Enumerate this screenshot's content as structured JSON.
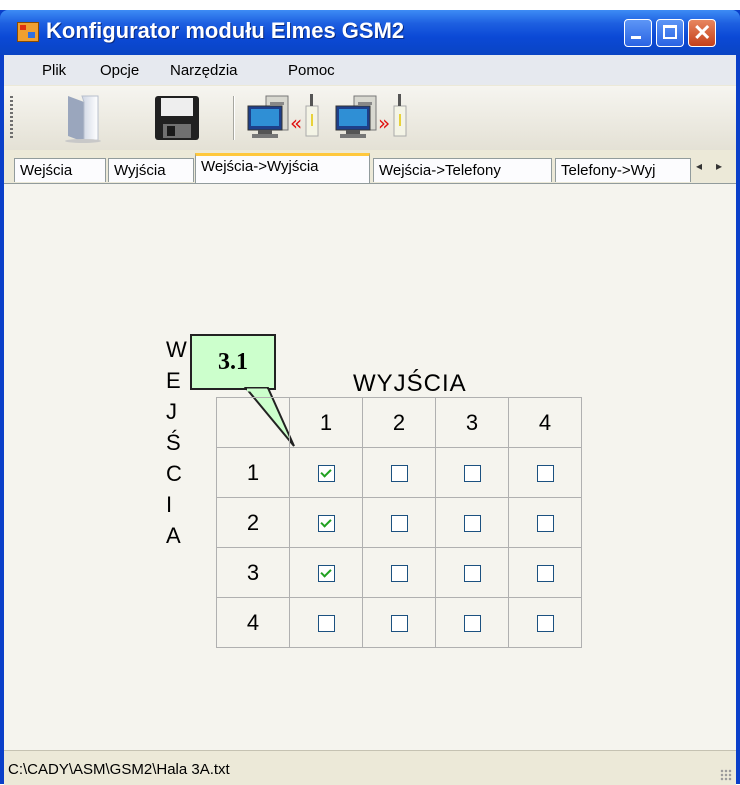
{
  "window": {
    "title": "Konfigurator modułu Elmes GSM2"
  },
  "menu": {
    "items": [
      "Plik",
      "Opcje",
      "Narzędzia",
      "Pomoc"
    ]
  },
  "toolbar": {
    "buttons": [
      "open-icon",
      "save-icon",
      "read-from-device-icon",
      "write-to-device-icon"
    ]
  },
  "tabs": {
    "items": [
      "Wejścia",
      "Wyjścia",
      "Wejścia->Wyjścia",
      "Wejścia->Telefony",
      "Telefony->Wyj"
    ],
    "active": "Wejścia->Wyjścia",
    "scroll": {
      "left": "◂",
      "right": "▸"
    }
  },
  "callout": {
    "label": "3.1"
  },
  "matrix": {
    "columns_title": "WYJŚCIA",
    "rows_title_letters": [
      "W",
      "E",
      "J",
      "Ś",
      "C",
      "I",
      "A"
    ],
    "column_headers": [
      "1",
      "2",
      "3",
      "4"
    ],
    "row_headers": [
      "1",
      "2",
      "3",
      "4"
    ],
    "checked": [
      [
        true,
        false,
        false,
        false
      ],
      [
        true,
        false,
        false,
        false
      ],
      [
        true,
        false,
        false,
        false
      ],
      [
        false,
        false,
        false,
        false
      ]
    ]
  },
  "status": {
    "path": "C:\\CADY\\ASM\\GSM2\\Hala 3A.txt"
  },
  "colors": {
    "titlebar": "#0a44c4",
    "callout_fill": "#ccffcc",
    "active_tab_accent": "#ffc83c",
    "check": "#21a121"
  }
}
